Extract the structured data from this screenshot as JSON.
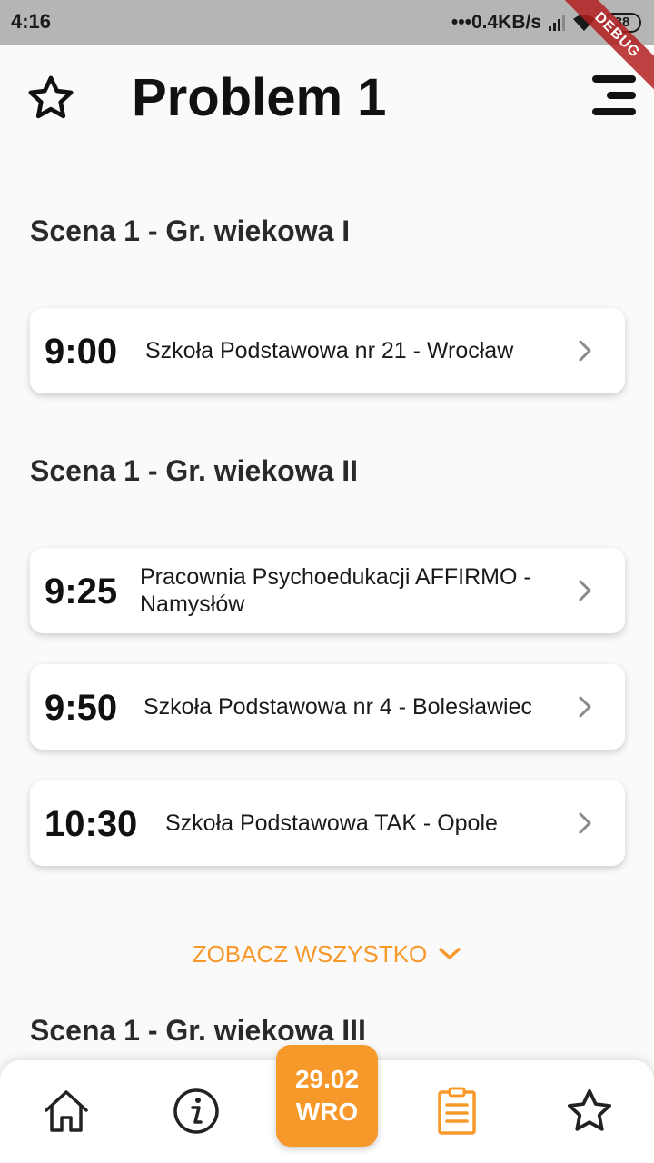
{
  "status_bar": {
    "time": "4:16",
    "network_speed": "•••0.4KB/s",
    "battery": "38",
    "debug_label": "DEBUG"
  },
  "header": {
    "title": "Problem 1",
    "favorite_icon": "star-outline-icon",
    "menu_icon": "menu-icon"
  },
  "sections": [
    {
      "title": "Scena 1 - Gr. wiekowa I",
      "items": [
        {
          "time": "9:00",
          "name": "Szkoła Podstawowa nr 21 - Wrocław"
        }
      ]
    },
    {
      "title": "Scena 1 - Gr. wiekowa II",
      "items": [
        {
          "time": "9:25",
          "name": "Pracownia Psychoedukacji AFFIRMO - Namysłów"
        },
        {
          "time": "9:50",
          "name": "Szkoła Podstawowa nr 4 - Bolesławiec"
        },
        {
          "time": "10:30",
          "name": "Szkoła Podstawowa TAK - Opole"
        }
      ],
      "see_all_label": "ZOBACZ WSZYSTKO"
    },
    {
      "title": "Scena 1 - Gr. wiekowa III",
      "items": []
    }
  ],
  "bottom_nav": {
    "date_day": "29.02",
    "date_city": "WRO",
    "items": [
      "home-icon",
      "info-icon",
      "date-badge",
      "schedule-icon",
      "favorites-icon"
    ]
  },
  "colors": {
    "accent": "#f7982a",
    "text": "#111111",
    "background": "#fafafa",
    "status_bar": "#b5b5b5"
  }
}
